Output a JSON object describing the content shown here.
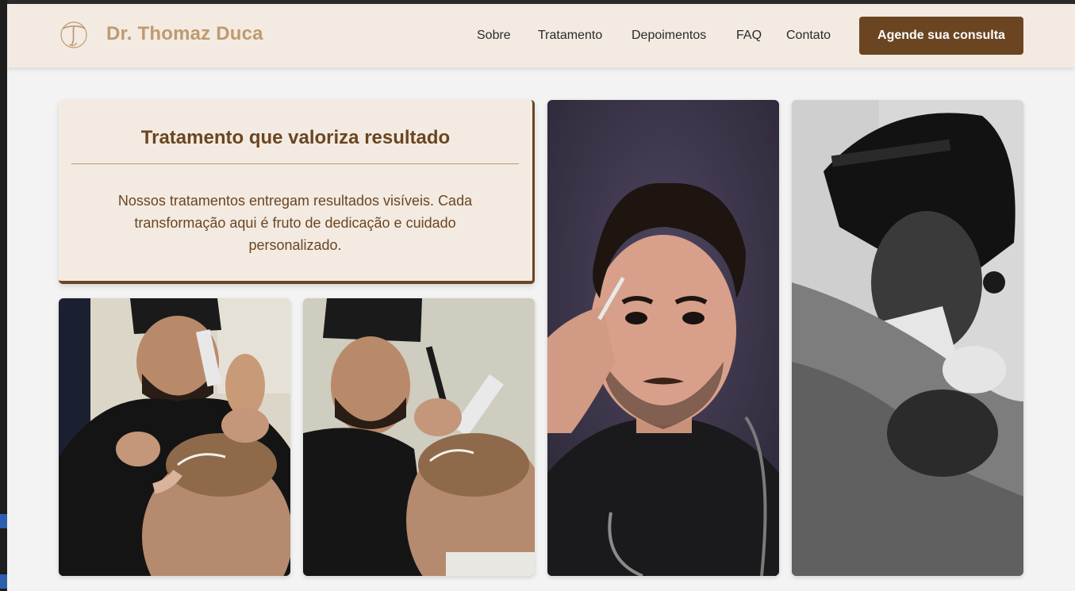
{
  "nav": {
    "brand": "Dr. Thomaz Duca",
    "links": [
      "Sobre",
      "Tratamento",
      "Depoimentos",
      "FAQ",
      "Contato"
    ],
    "cta": "Agende sua consulta"
  },
  "section": {
    "title": "Tratamento que valoriza resultado",
    "body": "Nossos tratamentos entregam resultados visíveis. Cada transformação aqui é fruto de dedicação e cuidado personalizado."
  },
  "gallery": {
    "photos": [
      "hairline-marking-photo-1",
      "hairline-marking-photo-2",
      "doctor-portrait-photo",
      "surgery-bw-photo"
    ]
  },
  "colors": {
    "accent": "#6b4522",
    "brand_gold": "#bf9a6f",
    "cream": "#f3ebe1",
    "page_bg": "#f3f3f3"
  }
}
